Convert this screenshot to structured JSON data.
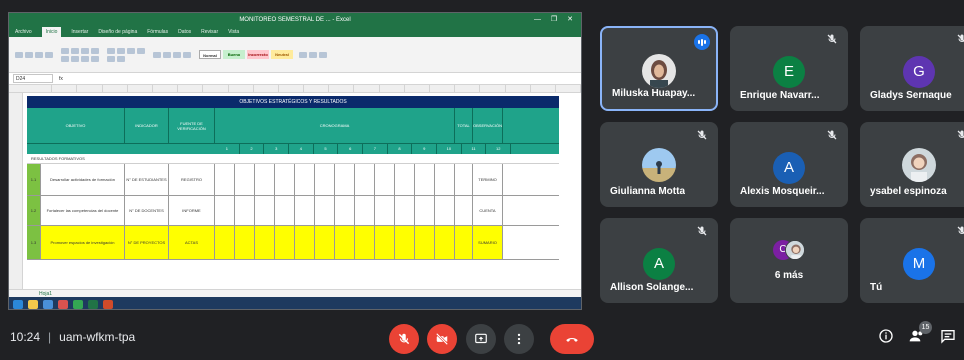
{
  "meeting": {
    "time": "10:24",
    "code": "uam-wfkm-tpa",
    "participant_count": "15"
  },
  "excel": {
    "window_title": "MONITOREO SEMESTRAL DE ... - Excel",
    "tabs": [
      "Archivo",
      "Inicio",
      "Insertar",
      "Diseño de página",
      "Fórmulas",
      "Datos",
      "Revisar",
      "Vista"
    ],
    "name_box": "D24",
    "style_labels": [
      "Normal",
      "Bueno",
      "Incorrecto",
      "Neutral"
    ],
    "band_title": "OBJETIVOS ESTRATÉGICOS Y RESULTADOS",
    "headers": [
      "OBJETIVO",
      "INDICADOR",
      "FUENTE DE VERIFICACIÓN",
      "CRONOGRAMA",
      "TOTAL",
      "OBSERVACIÓN"
    ],
    "months": [
      "1",
      "2",
      "3",
      "4",
      "5",
      "6",
      "7",
      "8",
      "9",
      "10",
      "11",
      "12"
    ],
    "section_label": "RESULTADOS FORMATIVOS",
    "rows": [
      {
        "code": "1.1",
        "desc": "Desarrollar actividades de formación",
        "ind": "N° DE ESTUDIANTES",
        "src": "REGISTRO",
        "obs": "TERMINO",
        "yellow": false
      },
      {
        "code": "1.2",
        "desc": "Fortalecer las competencias del docente",
        "ind": "N° DE DOCENTES",
        "src": "INFORME",
        "obs": "CUENTA",
        "yellow": false
      },
      {
        "code": "1.3",
        "desc": "Promover espacios de investigación",
        "ind": "N° DE PROYECTOS",
        "src": "ACTAS",
        "obs": "SUMARIO",
        "yellow": true
      }
    ],
    "sheet_tab": "Hoja1"
  },
  "participants": [
    {
      "name": "Miluska Huapay...",
      "type": "photo",
      "active": true,
      "muted": false
    },
    {
      "name": "Enrique Navarr...",
      "type": "initial",
      "initial": "E",
      "color": "#0b8043",
      "muted": true
    },
    {
      "name": "Gladys Sernaque",
      "type": "initial",
      "initial": "G",
      "color": "#5e35b1",
      "muted": true
    },
    {
      "name": "Giulianna Motta",
      "type": "photo",
      "muted": true
    },
    {
      "name": "Alexis Mosqueir...",
      "type": "initial",
      "initial": "A",
      "color": "#1a5fb4",
      "muted": true
    },
    {
      "name": "ysabel espinoza",
      "type": "photo",
      "muted": true
    },
    {
      "name": "Allison Solange...",
      "type": "initial",
      "initial": "A",
      "color": "#0b8043",
      "muted": true
    },
    {
      "more": "6 más",
      "initial": "C"
    },
    {
      "name": "Tú",
      "type": "initial",
      "initial": "M",
      "color": "#1a73e8",
      "muted": true
    }
  ],
  "colors": {
    "background": "#202124",
    "tile": "#3c4043",
    "danger": "#ea4335",
    "accent": "#8ab4f8"
  }
}
